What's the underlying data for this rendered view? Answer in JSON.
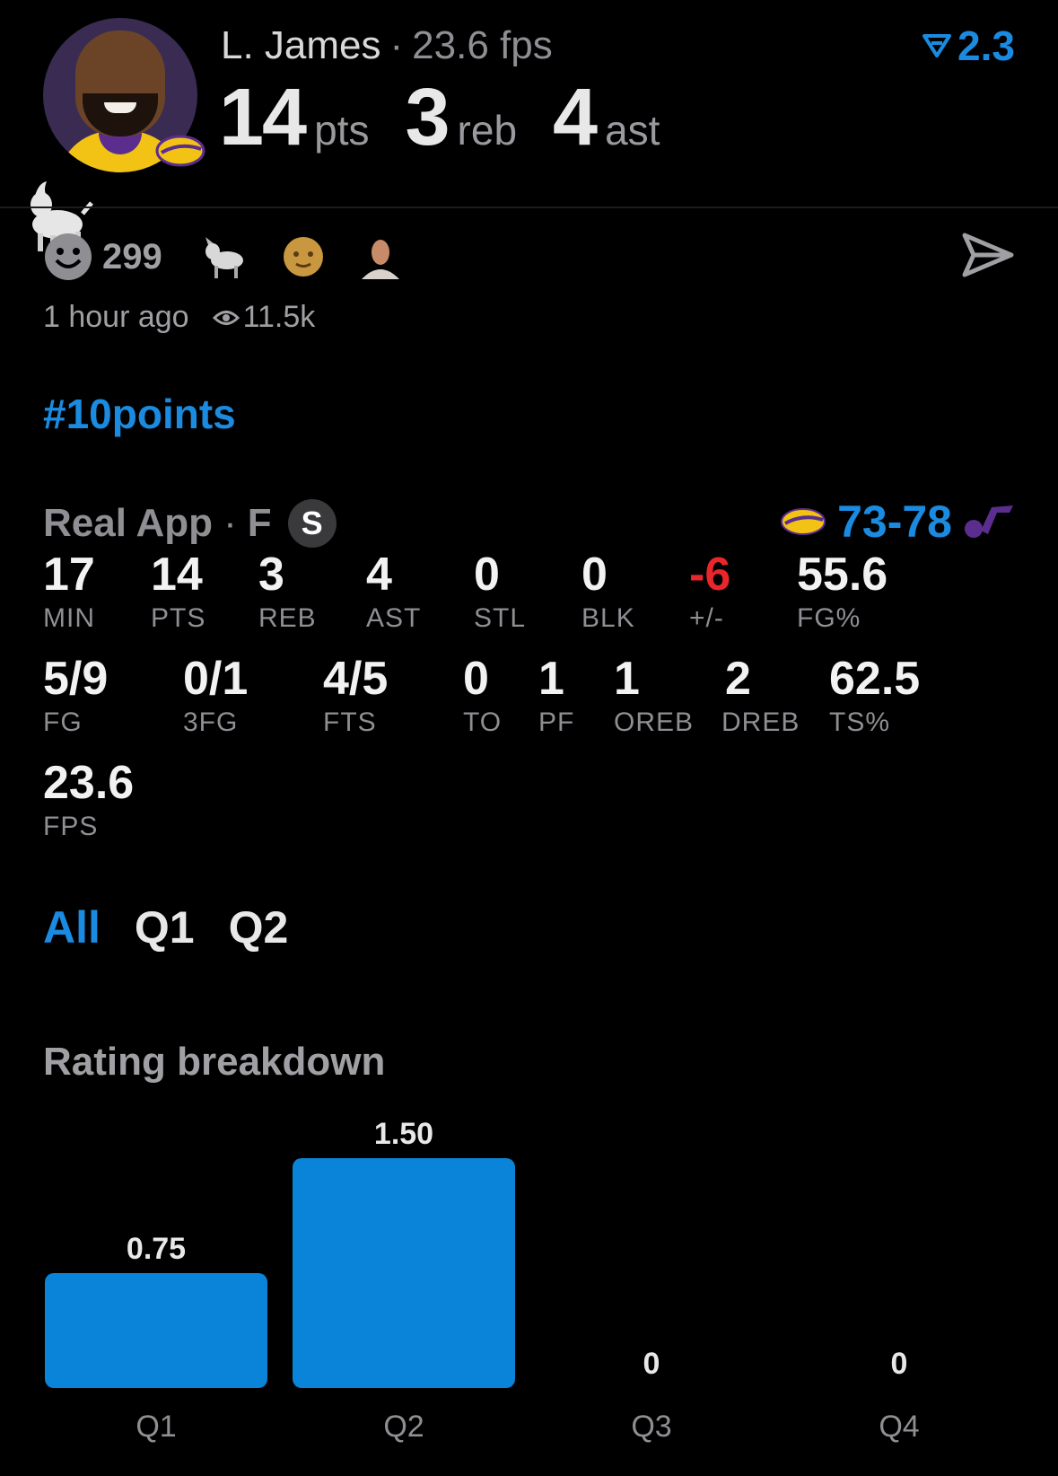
{
  "header": {
    "player_name": "L. James",
    "separator": "·",
    "fps_text": "23.6 fps",
    "rating_icon": "filter-triangle-icon",
    "rating_value": "2.3",
    "statline": [
      {
        "value": "14",
        "unit": "pts"
      },
      {
        "value": "3",
        "unit": "reb"
      },
      {
        "value": "4",
        "unit": "ast"
      }
    ]
  },
  "reactions": {
    "count": "299",
    "icons": [
      "goat-emoji-icon",
      "old-man-emoji-icon",
      "person-photo-icon"
    ]
  },
  "meta": {
    "time_ago": "1 hour ago",
    "views": "11.5k"
  },
  "hashtag": "#10points",
  "game": {
    "source": "Real App",
    "separator": "·",
    "position": "F",
    "badge": "S",
    "score": "73-78",
    "team_color": "#f2c314",
    "opponent_color": "#5b2d8e"
  },
  "stats": [
    {
      "value": "17",
      "label": "MIN"
    },
    {
      "value": "14",
      "label": "PTS"
    },
    {
      "value": "3",
      "label": "REB"
    },
    {
      "value": "4",
      "label": "AST"
    },
    {
      "value": "0",
      "label": "STL"
    },
    {
      "value": "0",
      "label": "BLK"
    },
    {
      "value": "-6",
      "label": "+/-"
    },
    {
      "value": "55.6",
      "label": "FG%"
    },
    {
      "value": "5/9",
      "label": "FG"
    },
    {
      "value": "0/1",
      "label": "3FG"
    },
    {
      "value": "4/5",
      "label": "FTS"
    },
    {
      "value": "0",
      "label": "TO"
    },
    {
      "value": "1",
      "label": "PF"
    },
    {
      "value": "1",
      "label": "OREB"
    },
    {
      "value": "2",
      "label": "DREB"
    },
    {
      "value": "62.5",
      "label": "TS%"
    },
    {
      "value": "23.6",
      "label": "FPS"
    }
  ],
  "tabs": [
    "All",
    "Q1",
    "Q2"
  ],
  "active_tab": "All",
  "rating_breakdown": {
    "title": "Rating breakdown"
  },
  "chart_data": {
    "type": "bar",
    "categories": [
      "Q1",
      "Q2",
      "Q3",
      "Q4"
    ],
    "values": [
      0.75,
      1.5,
      0,
      0
    ],
    "value_labels": [
      "0.75",
      "1.50",
      "0",
      "0"
    ],
    "ylim": [
      0,
      1.5
    ],
    "bar_color": "#0a84d8",
    "grid": false
  },
  "colors": {
    "accent": "#1a8be0",
    "negative": "#e8262b",
    "muted": "#8e8e93",
    "background": "#000000"
  }
}
